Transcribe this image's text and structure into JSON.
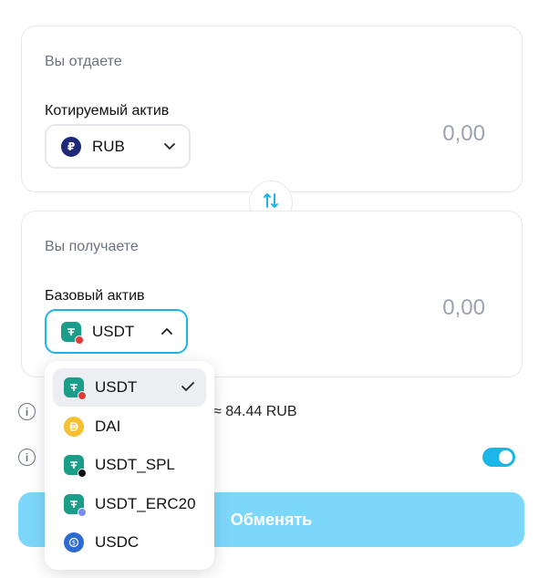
{
  "give": {
    "title": "Вы отдаете",
    "asset_label": "Котируемый актив",
    "asset": "RUB",
    "amount": "0,00"
  },
  "receive": {
    "title": "Вы получаете",
    "asset_label": "Базовый актив",
    "asset": "USDT",
    "amount": "0,00"
  },
  "rate_text": "≈ 84.44 RUB",
  "toggle_on": true,
  "exchange_button": "Обменять",
  "dropdown": {
    "items": [
      {
        "name": "USDT",
        "icon": "usdt-icon",
        "selected": true
      },
      {
        "name": "DAI",
        "icon": "dai-icon",
        "selected": false
      },
      {
        "name": "USDT_SPL",
        "icon": "usdt-spl-icon",
        "selected": false
      },
      {
        "name": "USDT_ERC20",
        "icon": "usdt-erc20-icon",
        "selected": false
      },
      {
        "name": "USDC",
        "icon": "usdc-icon",
        "selected": false
      }
    ]
  },
  "colors": {
    "accent": "#1ab6e9",
    "button": "#7dd7fb",
    "muted": "#9ca3af"
  }
}
